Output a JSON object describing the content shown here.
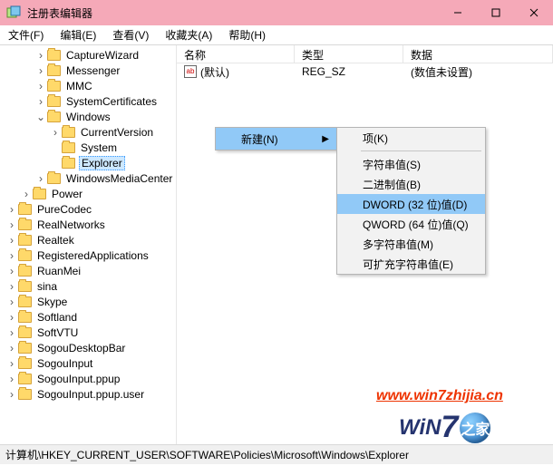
{
  "window": {
    "title": "注册表编辑器"
  },
  "menu": [
    "文件(F)",
    "编辑(E)",
    "查看(V)",
    "收藏夹(A)",
    "帮助(H)"
  ],
  "tree": [
    {
      "indent": 38,
      "tw": "›",
      "name": "CaptureWizard"
    },
    {
      "indent": 38,
      "tw": "›",
      "name": "Messenger"
    },
    {
      "indent": 38,
      "tw": "›",
      "name": "MMC"
    },
    {
      "indent": 38,
      "tw": "›",
      "name": "SystemCertificates"
    },
    {
      "indent": 38,
      "tw": "⌄",
      "name": "Windows"
    },
    {
      "indent": 54,
      "tw": "›",
      "name": "CurrentVersion"
    },
    {
      "indent": 54,
      "tw": "",
      "name": "System"
    },
    {
      "indent": 54,
      "tw": "",
      "name": "Explorer",
      "sel": true
    },
    {
      "indent": 38,
      "tw": "›",
      "name": "WindowsMediaCenter"
    },
    {
      "indent": 22,
      "tw": "›",
      "name": "Power"
    },
    {
      "indent": 6,
      "tw": "›",
      "name": "PureCodec"
    },
    {
      "indent": 6,
      "tw": "›",
      "name": "RealNetworks"
    },
    {
      "indent": 6,
      "tw": "›",
      "name": "Realtek"
    },
    {
      "indent": 6,
      "tw": "›",
      "name": "RegisteredApplications"
    },
    {
      "indent": 6,
      "tw": "›",
      "name": "RuanMei"
    },
    {
      "indent": 6,
      "tw": "›",
      "name": "sina"
    },
    {
      "indent": 6,
      "tw": "›",
      "name": "Skype"
    },
    {
      "indent": 6,
      "tw": "›",
      "name": "Softland"
    },
    {
      "indent": 6,
      "tw": "›",
      "name": "SoftVTU"
    },
    {
      "indent": 6,
      "tw": "›",
      "name": "SogouDesktopBar"
    },
    {
      "indent": 6,
      "tw": "›",
      "name": "SogouInput"
    },
    {
      "indent": 6,
      "tw": "›",
      "name": "SogouInput.ppup"
    },
    {
      "indent": 6,
      "tw": "›",
      "name": "SogouInput.ppup.user"
    }
  ],
  "list": {
    "columns": [
      "名称",
      "类型",
      "数据"
    ],
    "rows": [
      {
        "name": "(默认)",
        "type": "REG_SZ",
        "data": "(数值未设置)"
      }
    ]
  },
  "ctx": {
    "parent": "新建(N)",
    "items": [
      {
        "label": "项(K)",
        "sep_after": true
      },
      {
        "label": "字符串值(S)"
      },
      {
        "label": "二进制值(B)"
      },
      {
        "label": "DWORD (32 位)值(D)",
        "sel": true
      },
      {
        "label": "QWORD (64 位)值(Q)"
      },
      {
        "label": "多字符串值(M)"
      },
      {
        "label": "可扩充字符串值(E)"
      }
    ]
  },
  "statusbar": "计算机\\HKEY_CURRENT_USER\\SOFTWARE\\Policies\\Microsoft\\Windows\\Explorer",
  "watermark": {
    "url": "www.win7zhijia.cn",
    "logo_text": "WiN",
    "logo_digit": "7",
    "logo_suffix": "之家"
  }
}
